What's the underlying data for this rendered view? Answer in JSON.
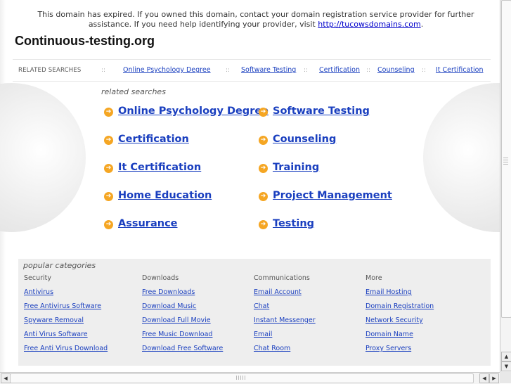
{
  "notice": {
    "text": "This domain has expired. If you owned this domain, contact your domain registration service provider for further assistance. If you need help identifying your provider, visit ",
    "link": "http://tucowsdomains.com",
    "end": "."
  },
  "site_title": "Continuous-testing.org",
  "related_bar": {
    "label": "RELATED SEARCHES",
    "separator": "::",
    "links": [
      "Online Psychology Degree",
      "Software Testing",
      "Certification",
      "Counseling",
      "It Certification"
    ]
  },
  "related_searches": {
    "heading": "related searches",
    "arrow_icon": "orange-arrow-circle-icon",
    "items": [
      "Online Psychology Degree",
      "Software Testing",
      "Certification",
      "Counseling",
      "It Certification",
      "Training",
      "Home Education",
      "Project Management",
      "Assurance",
      "Testing"
    ]
  },
  "popular": {
    "title": "popular categories",
    "columns": [
      {
        "heading": "Security",
        "links": [
          "Antivirus",
          "Free Antivirus Software",
          "Spyware Removal",
          "Anti Virus Software",
          "Free Anti Virus Download"
        ]
      },
      {
        "heading": "Downloads",
        "links": [
          "Free Downloads",
          "Download Music",
          "Download Full Movie",
          "Free Music Download",
          "Download Free Software"
        ]
      },
      {
        "heading": "Communications",
        "links": [
          "Email Account",
          "Chat",
          "Instant Messenger",
          "Email",
          "Chat Room"
        ]
      },
      {
        "heading": "More",
        "links": [
          "Email Hosting",
          "Domain Registration",
          "Network Security",
          "Domain Name",
          "Proxy Servers"
        ]
      }
    ]
  },
  "colors": {
    "link": "#1a3fbf",
    "arrow": "#f5a623",
    "panel": "#eeeeee"
  }
}
